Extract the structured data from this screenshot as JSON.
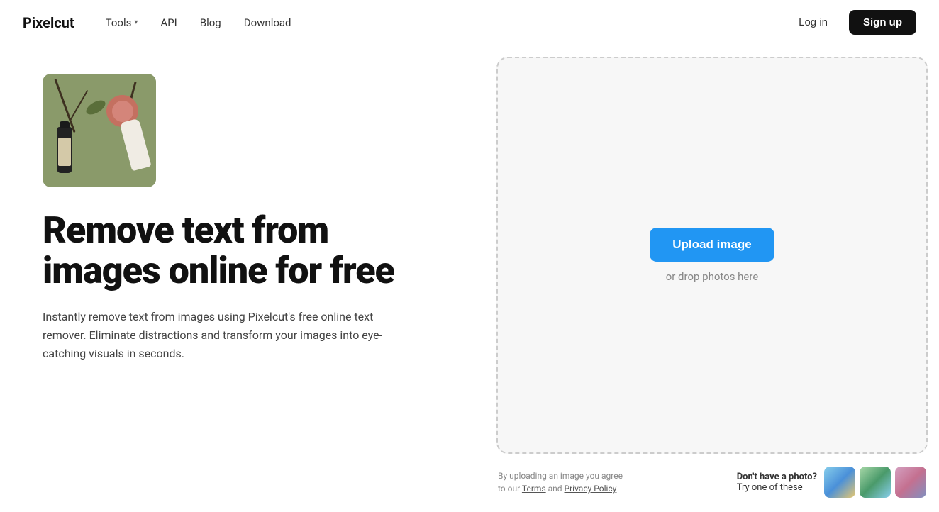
{
  "nav": {
    "logo": "Pixelcut",
    "links": [
      {
        "label": "Tools",
        "hasDropdown": true
      },
      {
        "label": "API",
        "hasDropdown": false
      },
      {
        "label": "Blog",
        "hasDropdown": false
      },
      {
        "label": "Download",
        "hasDropdown": false
      }
    ],
    "login_label": "Log in",
    "signup_label": "Sign up"
  },
  "hero": {
    "headline_line1": "Remove text from",
    "headline_line2": "images online for free",
    "description": "Instantly remove text from images using Pixelcut's free online text remover. Eliminate distractions and transform your images into eye-catching visuals in seconds."
  },
  "upload": {
    "button_label": "Upload image",
    "drop_hint": "or drop photos here",
    "terms_line1": "By uploading an image you agree",
    "terms_line2": "to our Terms and Privacy Policy",
    "sample_heading": "Don't have a photo?",
    "sample_subheading": "Try one of these"
  }
}
